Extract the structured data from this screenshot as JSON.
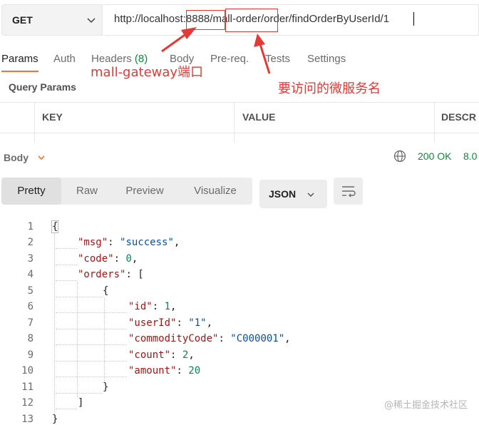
{
  "request": {
    "method": "GET",
    "url_prefix": "http://localho",
    "url_st": "st",
    "url_port": ":8888",
    "url_slash": "/",
    "url_service": "mall-order",
    "url_path": "/order/findOrderByUserId/1"
  },
  "tabs": [
    {
      "label": "Params",
      "active": true
    },
    {
      "label": "Auth"
    },
    {
      "label": "Headers",
      "count": "(8)"
    },
    {
      "label": "Body"
    },
    {
      "label": "Pre-req."
    },
    {
      "label": "Tests"
    },
    {
      "label": "Settings"
    }
  ],
  "query_params": {
    "title": "Query Params",
    "columns": [
      "KEY",
      "VALUE",
      "DESCR"
    ]
  },
  "response": {
    "label": "Body",
    "status": "200 OK",
    "size": "8.0",
    "views": [
      "Pretty",
      "Raw",
      "Preview",
      "Visualize"
    ],
    "active_view": "Pretty",
    "format": "JSON"
  },
  "code": {
    "line_numbers": [
      "1",
      "2",
      "3",
      "4",
      "5",
      "6",
      "7",
      "8",
      "9",
      "10",
      "11",
      "12",
      "13"
    ],
    "open_brace": "{",
    "k_msg": "\"msg\"",
    "v_msg": "\"success\"",
    "k_code": "\"code\"",
    "v_code": "0",
    "k_orders": "\"orders\"",
    "open_bracket": "[",
    "obj_open": "{",
    "k_id": "\"id\"",
    "v_id": "1",
    "k_userId": "\"userId\"",
    "v_userId": "\"1\"",
    "k_commodityCode": "\"commodityCode\"",
    "v_commodityCode": "\"C000001\"",
    "k_count": "\"count\"",
    "v_count": "2",
    "k_amount": "\"amount\"",
    "v_amount": "20",
    "obj_close": "}",
    "close_bracket": "]",
    "close_brace": "}"
  },
  "annotations": {
    "gateway_port": "mall-gateway端口",
    "service_name": "要访问的微服务名"
  },
  "watermark": "@稀土掘金技术社区",
  "colors": {
    "accent": "#ff6c37",
    "status_ok": "#0a8a3a",
    "annotation": "#e53935"
  }
}
